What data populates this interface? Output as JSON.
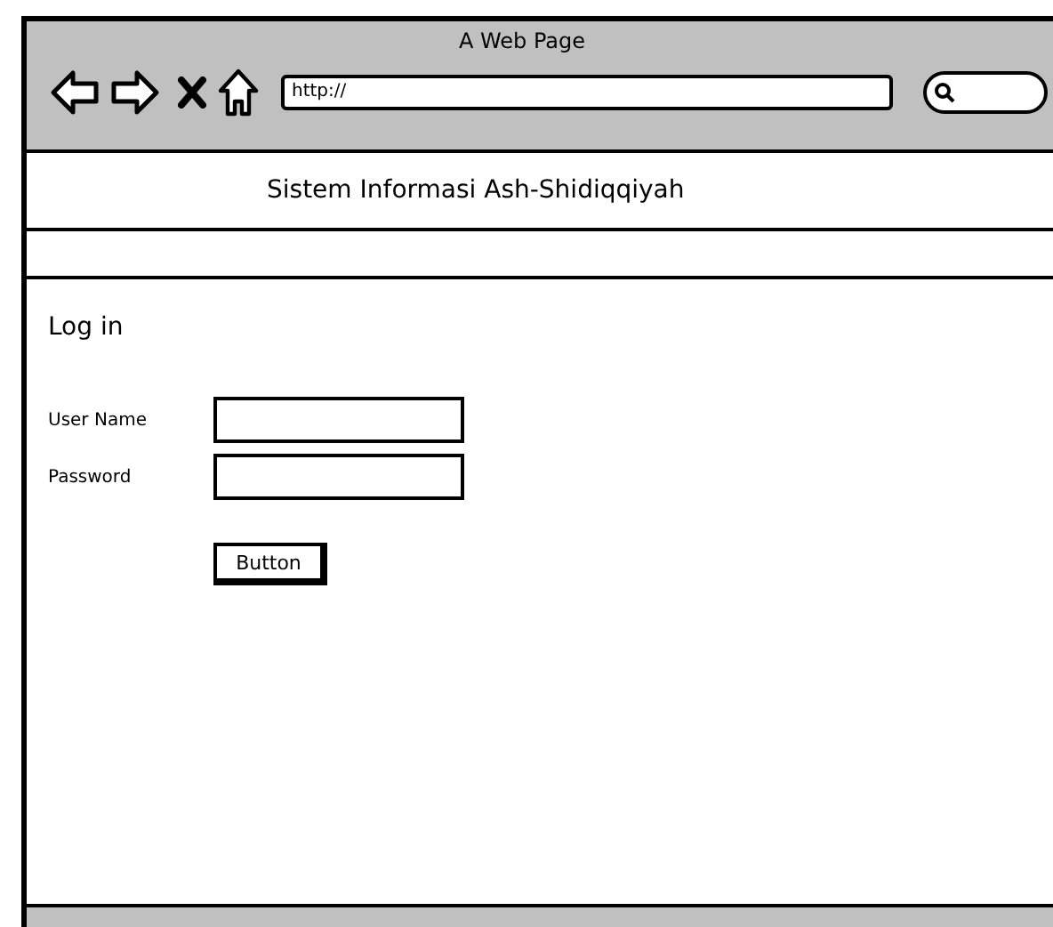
{
  "browser": {
    "title": "A Web Page",
    "url": "http://"
  },
  "header": {
    "title": "Sistem Informasi Ash-Shidiqqiyah"
  },
  "login": {
    "heading": "Log in",
    "fields": [
      {
        "label": "User Name"
      },
      {
        "label": "Password"
      }
    ],
    "button": "Button"
  }
}
